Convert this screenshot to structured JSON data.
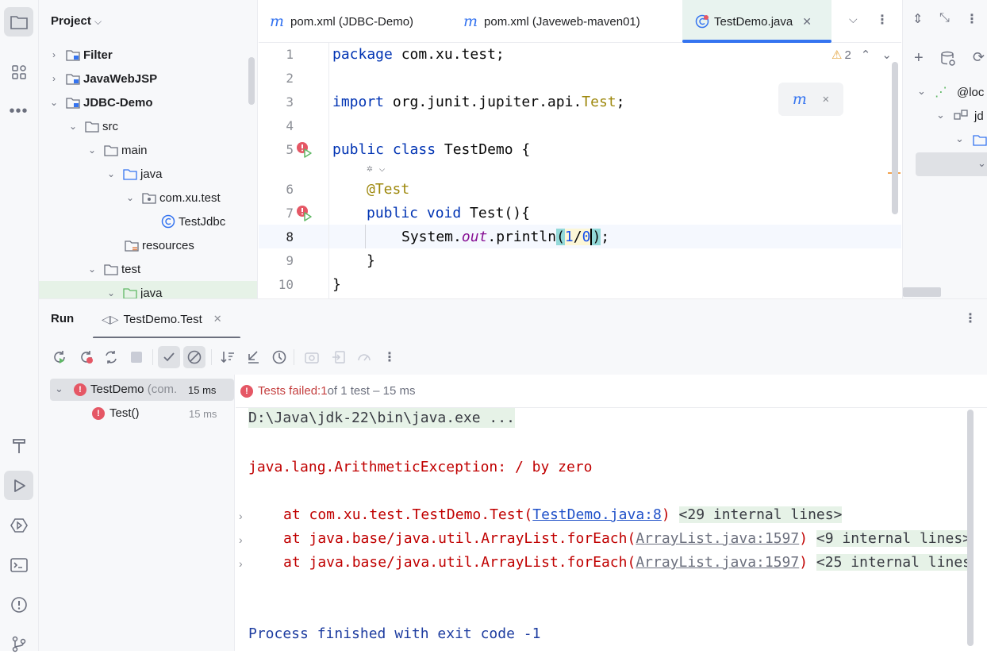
{
  "project": {
    "title": "Project",
    "tree": [
      {
        "label": "Filter",
        "bold": true
      },
      {
        "label": "JavaWebJSP",
        "bold": true
      },
      {
        "label": "JDBC-Demo",
        "bold": true
      },
      {
        "label": "src"
      },
      {
        "label": "main"
      },
      {
        "label": "java"
      },
      {
        "label": "com.xu.test"
      },
      {
        "label": "TestJdbc"
      },
      {
        "label": "resources"
      },
      {
        "label": "test"
      },
      {
        "label": "java"
      }
    ]
  },
  "tabs": [
    {
      "label": "pom.xml (JDBC-Demo)"
    },
    {
      "label": "pom.xml (Javeweb-maven01)"
    },
    {
      "label": "TestDemo.java"
    }
  ],
  "editor": {
    "warning_count": "2",
    "line_numbers": [
      "1",
      "2",
      "3",
      "4",
      "5",
      "6",
      "7",
      "8",
      "9",
      "10"
    ],
    "code": {
      "l1_kw": "package",
      "l1_rest": " com.xu.test;",
      "l3_kw": "import",
      "l3_pkg": " org.junit.jupiter.api.",
      "l3_cls": "Test",
      "l3_end": ";",
      "l5_kw": "public class",
      "l5_rest": " TestDemo {",
      "l6_ann": "@Test",
      "l7_kw": "public void",
      "l7_rest": " Test(){",
      "l8_a": "System.",
      "l8_out": "out",
      "l8_b": ".println",
      "l8_paren_open": "(",
      "l8_num1": "1",
      "l8_slash": "/",
      "l8_num2": "0",
      "l8_paren_close": ")",
      "l8_end": ";",
      "l9": "}",
      "l10": "}"
    }
  },
  "right_pane": {
    "item1": "@loc",
    "item2": "jd"
  },
  "run": {
    "title": "Run",
    "tab_label": "TestDemo.Test",
    "tree": {
      "root_label": "TestDemo",
      "root_pkg": "(com.",
      "root_time": "15 ms",
      "child_label": "Test()",
      "child_time": "15 ms"
    },
    "status": {
      "prefix": "Tests failed: ",
      "count": "1",
      "suffix": " of 1 test – 15 ms"
    },
    "console": {
      "cmd": "D:\\Java\\jdk-22\\bin\\java.exe ...",
      "exception": "java.lang.ArithmeticException: / by zero",
      "frames": [
        {
          "prefix": "at com.xu.test.TestDemo.Test(",
          "link": "TestDemo.java:8",
          "suffix": ")",
          "fold": "<29 internal lines>"
        },
        {
          "prefix": "at java.base/java.util.ArrayList.forEach(",
          "link": "ArrayList.java:1597",
          "suffix": ")",
          "fold": "<9 internal lines>"
        },
        {
          "prefix": "at java.base/java.util.ArrayList.forEach(",
          "link": "ArrayList.java:1597",
          "suffix": ")",
          "fold": "<25 internal lines"
        }
      ],
      "exit": "Process finished with exit code -1"
    }
  }
}
